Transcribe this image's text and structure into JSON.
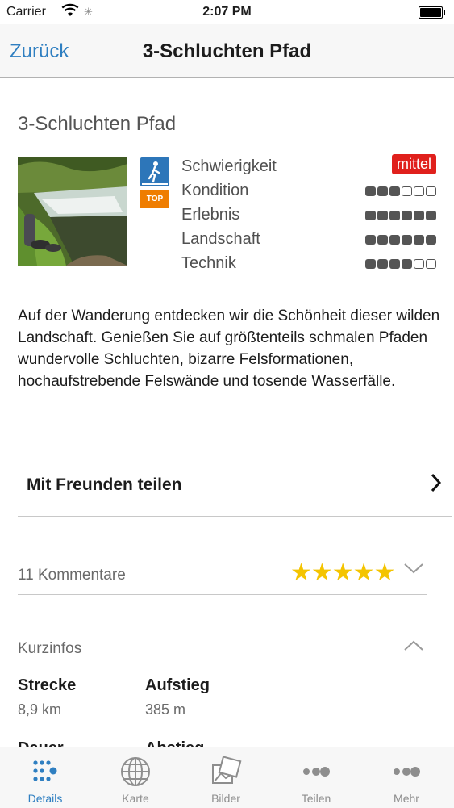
{
  "status_bar": {
    "carrier": "Carrier",
    "time": "2:07 PM"
  },
  "nav": {
    "back_label": "Zurück",
    "title": "3-Schluchten Pfad"
  },
  "route": {
    "title": "3-Schluchten Pfad",
    "top_badge": "TOP",
    "ratings": [
      {
        "label": "Schwierigkeit",
        "tag": "mittel"
      },
      {
        "label": "Kondition",
        "filled": 3,
        "max": 6
      },
      {
        "label": "Erlebnis",
        "filled": 6,
        "max": 6
      },
      {
        "label": "Landschaft",
        "filled": 6,
        "max": 6
      },
      {
        "label": "Technik",
        "filled": 4,
        "max": 6
      }
    ],
    "description": "Auf der Wanderung entdecken wir die Schönheit dieser wilden Landschaft. Genießen Sie auf größtenteils schmalen Pfaden wundervolle Schluchten, bizarre Felsformationen, hochaufstrebende Felswände und tosende Wasserfälle."
  },
  "share": {
    "label": "Mit Freunden teilen"
  },
  "comments": {
    "label": "11 Kommentare",
    "rating": 5,
    "stars": "★★★★★"
  },
  "kurzinfos": {
    "label": "Kurzinfos",
    "items": [
      {
        "key": "Strecke",
        "value": "8,9 km"
      },
      {
        "key": "Aufstieg",
        "value": "385 m"
      },
      {
        "key": "Dauer",
        "value": ""
      },
      {
        "key": "Abstieg",
        "value": ""
      }
    ]
  },
  "tabs": [
    {
      "label": "Details",
      "icon": "dots-grid-icon",
      "active": true
    },
    {
      "label": "Karte",
      "icon": "globe-icon",
      "active": false
    },
    {
      "label": "Bilder",
      "icon": "photos-icon",
      "active": false
    },
    {
      "label": "Teilen",
      "icon": "share-dots-icon",
      "active": false
    },
    {
      "label": "Mehr",
      "icon": "more-dots-icon",
      "active": false
    }
  ],
  "colors": {
    "accent": "#2f7fc1",
    "difficulty_tag": "#e0201c",
    "hike_badge": "#2d76b9",
    "top_badge": "#ef7d00",
    "star": "#f4c400"
  }
}
